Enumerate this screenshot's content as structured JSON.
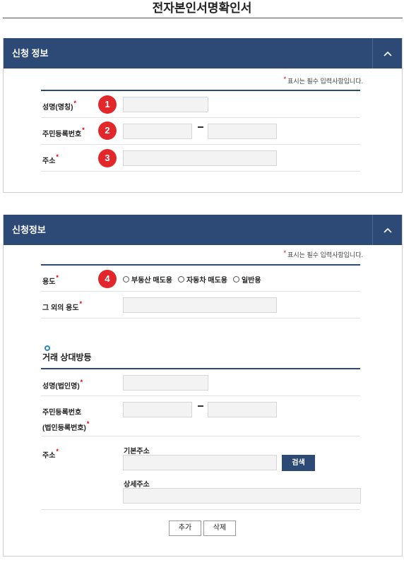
{
  "page": {
    "title": "전자본인서명확인서"
  },
  "required_note": {
    "marker": "*",
    "text": "표시는 필수 입력사항입니다."
  },
  "panel1": {
    "header": "신청 정보",
    "fields": {
      "name_label": "성명(명칭)",
      "resident_label": "주민등록번호",
      "address_label": "주소"
    },
    "badges": [
      "1",
      "2",
      "3"
    ]
  },
  "panel2": {
    "header": "신청정보",
    "purpose_label": "용도",
    "purpose_badge": "4",
    "purpose_options": [
      "부동산 매도용",
      "자동차 매도용",
      "일반용"
    ],
    "other_purpose_label": "그 외의 용도",
    "counterparty": {
      "heading": "거래 상대방등",
      "name_label": "성명(법인명)",
      "resident_label_line1": "주민등록번호",
      "resident_label_line2": "(법인등록번호)",
      "address_label": "주소",
      "basic_address_label": "기본주소",
      "detail_address_label": "상세주소",
      "search_button": "검색"
    },
    "buttons": {
      "add": "추가",
      "delete": "삭제"
    }
  },
  "colors": {
    "header_bg": "#2d4a77",
    "badge_red": "#e2262a",
    "required_red": "#dd0000"
  },
  "icons": {
    "toggle": "chevron-up-icon",
    "section_marker": "ring-icon"
  }
}
